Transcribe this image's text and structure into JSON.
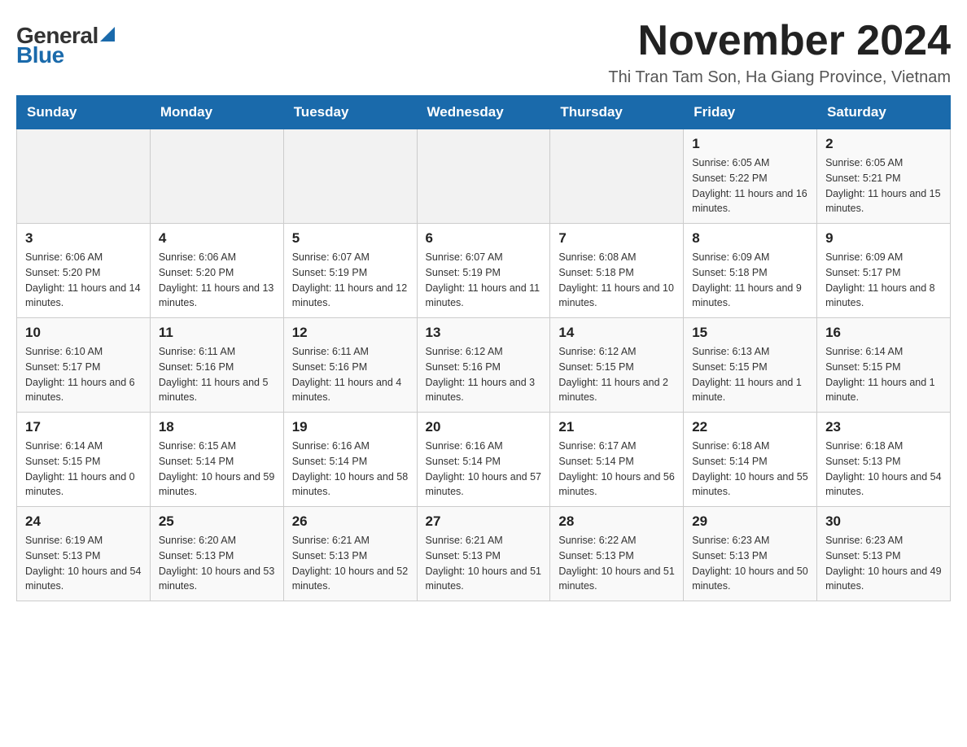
{
  "logo": {
    "general": "General",
    "blue": "Blue",
    "arrow_char": "▲"
  },
  "title": "November 2024",
  "location": "Thi Tran Tam Son, Ha Giang Province, Vietnam",
  "weekdays": [
    "Sunday",
    "Monday",
    "Tuesday",
    "Wednesday",
    "Thursday",
    "Friday",
    "Saturday"
  ],
  "weeks": [
    [
      {
        "day": "",
        "info": ""
      },
      {
        "day": "",
        "info": ""
      },
      {
        "day": "",
        "info": ""
      },
      {
        "day": "",
        "info": ""
      },
      {
        "day": "",
        "info": ""
      },
      {
        "day": "1",
        "info": "Sunrise: 6:05 AM\nSunset: 5:22 PM\nDaylight: 11 hours and 16 minutes."
      },
      {
        "day": "2",
        "info": "Sunrise: 6:05 AM\nSunset: 5:21 PM\nDaylight: 11 hours and 15 minutes."
      }
    ],
    [
      {
        "day": "3",
        "info": "Sunrise: 6:06 AM\nSunset: 5:20 PM\nDaylight: 11 hours and 14 minutes."
      },
      {
        "day": "4",
        "info": "Sunrise: 6:06 AM\nSunset: 5:20 PM\nDaylight: 11 hours and 13 minutes."
      },
      {
        "day": "5",
        "info": "Sunrise: 6:07 AM\nSunset: 5:19 PM\nDaylight: 11 hours and 12 minutes."
      },
      {
        "day": "6",
        "info": "Sunrise: 6:07 AM\nSunset: 5:19 PM\nDaylight: 11 hours and 11 minutes."
      },
      {
        "day": "7",
        "info": "Sunrise: 6:08 AM\nSunset: 5:18 PM\nDaylight: 11 hours and 10 minutes."
      },
      {
        "day": "8",
        "info": "Sunrise: 6:09 AM\nSunset: 5:18 PM\nDaylight: 11 hours and 9 minutes."
      },
      {
        "day": "9",
        "info": "Sunrise: 6:09 AM\nSunset: 5:17 PM\nDaylight: 11 hours and 8 minutes."
      }
    ],
    [
      {
        "day": "10",
        "info": "Sunrise: 6:10 AM\nSunset: 5:17 PM\nDaylight: 11 hours and 6 minutes."
      },
      {
        "day": "11",
        "info": "Sunrise: 6:11 AM\nSunset: 5:16 PM\nDaylight: 11 hours and 5 minutes."
      },
      {
        "day": "12",
        "info": "Sunrise: 6:11 AM\nSunset: 5:16 PM\nDaylight: 11 hours and 4 minutes."
      },
      {
        "day": "13",
        "info": "Sunrise: 6:12 AM\nSunset: 5:16 PM\nDaylight: 11 hours and 3 minutes."
      },
      {
        "day": "14",
        "info": "Sunrise: 6:12 AM\nSunset: 5:15 PM\nDaylight: 11 hours and 2 minutes."
      },
      {
        "day": "15",
        "info": "Sunrise: 6:13 AM\nSunset: 5:15 PM\nDaylight: 11 hours and 1 minute."
      },
      {
        "day": "16",
        "info": "Sunrise: 6:14 AM\nSunset: 5:15 PM\nDaylight: 11 hours and 1 minute."
      }
    ],
    [
      {
        "day": "17",
        "info": "Sunrise: 6:14 AM\nSunset: 5:15 PM\nDaylight: 11 hours and 0 minutes."
      },
      {
        "day": "18",
        "info": "Sunrise: 6:15 AM\nSunset: 5:14 PM\nDaylight: 10 hours and 59 minutes."
      },
      {
        "day": "19",
        "info": "Sunrise: 6:16 AM\nSunset: 5:14 PM\nDaylight: 10 hours and 58 minutes."
      },
      {
        "day": "20",
        "info": "Sunrise: 6:16 AM\nSunset: 5:14 PM\nDaylight: 10 hours and 57 minutes."
      },
      {
        "day": "21",
        "info": "Sunrise: 6:17 AM\nSunset: 5:14 PM\nDaylight: 10 hours and 56 minutes."
      },
      {
        "day": "22",
        "info": "Sunrise: 6:18 AM\nSunset: 5:14 PM\nDaylight: 10 hours and 55 minutes."
      },
      {
        "day": "23",
        "info": "Sunrise: 6:18 AM\nSunset: 5:13 PM\nDaylight: 10 hours and 54 minutes."
      }
    ],
    [
      {
        "day": "24",
        "info": "Sunrise: 6:19 AM\nSunset: 5:13 PM\nDaylight: 10 hours and 54 minutes."
      },
      {
        "day": "25",
        "info": "Sunrise: 6:20 AM\nSunset: 5:13 PM\nDaylight: 10 hours and 53 minutes."
      },
      {
        "day": "26",
        "info": "Sunrise: 6:21 AM\nSunset: 5:13 PM\nDaylight: 10 hours and 52 minutes."
      },
      {
        "day": "27",
        "info": "Sunrise: 6:21 AM\nSunset: 5:13 PM\nDaylight: 10 hours and 51 minutes."
      },
      {
        "day": "28",
        "info": "Sunrise: 6:22 AM\nSunset: 5:13 PM\nDaylight: 10 hours and 51 minutes."
      },
      {
        "day": "29",
        "info": "Sunrise: 6:23 AM\nSunset: 5:13 PM\nDaylight: 10 hours and 50 minutes."
      },
      {
        "day": "30",
        "info": "Sunrise: 6:23 AM\nSunset: 5:13 PM\nDaylight: 10 hours and 49 minutes."
      }
    ]
  ]
}
